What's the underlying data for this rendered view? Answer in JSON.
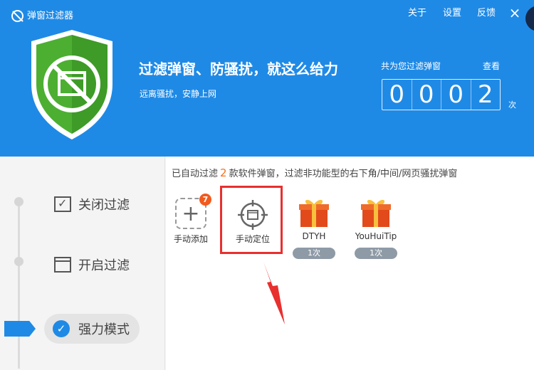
{
  "header": {
    "app_title": "弹窗过滤器",
    "menu": [
      "关于",
      "设置",
      "反馈"
    ],
    "close_glyph": "×",
    "headline": "过滤弹窗、防骚扰，就这么给力",
    "subline": "远离骚扰，安静上网",
    "counter_label": "共为您过滤弹窗",
    "view_label": "查看",
    "counter_digits": [
      "0",
      "0",
      "0",
      "2"
    ],
    "counter_unit": "次"
  },
  "modes": {
    "off_label": "关闭过滤",
    "on_label": "开启过滤",
    "strong_label": "强力模式",
    "active": "强力模式"
  },
  "summary": {
    "prefix": "已自动过滤",
    "count": "2",
    "suffix": "款软件弹窗，过滤非功能型的右下角/中间/网页骚扰弹窗"
  },
  "items": {
    "manual_add": {
      "label": "手动添加",
      "badge": "7",
      "glyph": "+"
    },
    "manual_locate": {
      "label": "手动定位"
    },
    "software": [
      {
        "name": "DTYH",
        "count": "1次"
      },
      {
        "name": "YouHuiTip",
        "count": "1次"
      }
    ]
  },
  "icons": {
    "shield": "shield-icon",
    "locate": "crosshair-window-icon",
    "gift": "gift-box-icon",
    "arrow": "red-arrow-icon"
  },
  "colors": {
    "brand_blue": "#1f8ae6",
    "shield_green": "#4caf32",
    "highlight_red": "#e8302f",
    "badge_orange": "#f25a1e",
    "count_orange": "#f7701b"
  }
}
